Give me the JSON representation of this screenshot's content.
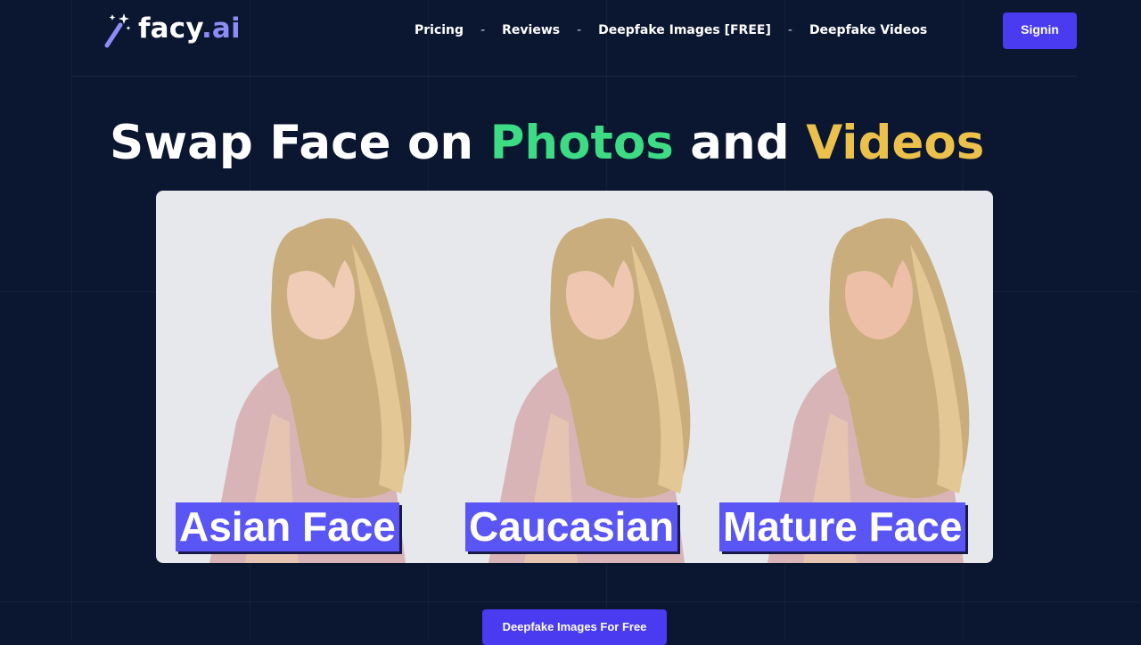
{
  "brand": {
    "name_main": "facy",
    "name_suffix": ".ai"
  },
  "nav": {
    "items": [
      {
        "label": "Pricing"
      },
      {
        "label": "Reviews"
      },
      {
        "label": "Deepfake Images [FREE]"
      },
      {
        "label": "Deepfake Videos"
      }
    ],
    "separator": "-"
  },
  "auth": {
    "signin_label": "Signin"
  },
  "hero": {
    "title_part1": "Swap Face on ",
    "title_highlight1": "Photos",
    "title_part2": " and ",
    "title_highlight2": "Videos"
  },
  "gallery": {
    "panels": [
      {
        "label": "Asian Face",
        "image": "woman-portrait-asian"
      },
      {
        "label": "Caucasian",
        "image": "woman-portrait-caucasian"
      },
      {
        "label": "Mature Face",
        "image": "woman-portrait-mature"
      }
    ]
  },
  "cta": {
    "label": "Deepfake Images For Free"
  },
  "colors": {
    "background": "#0b1630",
    "accent": "#4a3af0",
    "label_bg": "#5a55f5",
    "highlight_green": "#3ddc84",
    "highlight_yellow": "#ebc14b",
    "logo_ai": "#8d8cf6"
  }
}
